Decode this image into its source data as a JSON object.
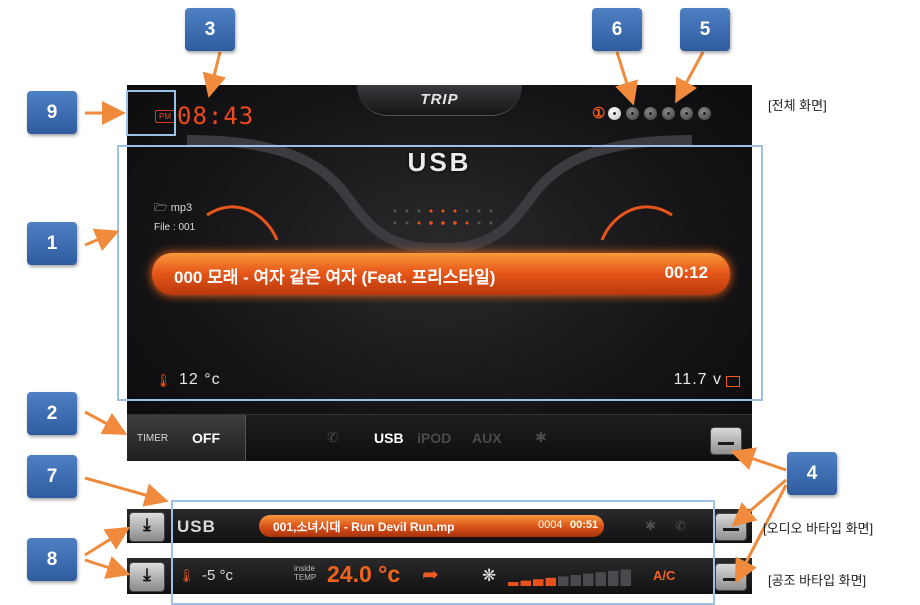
{
  "main_screen": {
    "mode_tab": "TRIP",
    "clock_period": "PM",
    "clock_time": "08:43",
    "page_number": "①",
    "page_count": 6,
    "active_page": 1,
    "source_title": "USB",
    "folder_name": "mp3",
    "file_label": "File : 001",
    "track_title": "000  모래 - 여자 같은 여자 (Feat. 프리스타일)",
    "track_time": "00:12",
    "temperature": "12 °c",
    "voltage": "11.7 v"
  },
  "source_bar": {
    "timer_label": "TIMER",
    "timer_value": "OFF",
    "sources": [
      "USB",
      "iPOD",
      "AUX"
    ],
    "active_source": "USB",
    "phone_icon": "phone-icon",
    "bluetooth_icon": "bluetooth-icon"
  },
  "audio_strip": {
    "source": "USB",
    "track": "001,소녀시대 - Run Devil Run.mp",
    "track_number": "0004",
    "time": "00:51"
  },
  "hvac_strip": {
    "outside_temp": "-5 °c",
    "inside_label": "inside TEMP",
    "inside_temp": "24.0 °c",
    "ac_label": "A/C",
    "fan_level": 4,
    "fan_levels_total": 10
  },
  "annotations": {
    "callouts": [
      "1",
      "2",
      "3",
      "4",
      "5",
      "6",
      "7",
      "8",
      "9"
    ],
    "full_screen_note": "[전체 화면]",
    "audio_strip_note": "[오디오 바타입 화면]",
    "hvac_strip_note": "[공조 바타입 화면]"
  },
  "colors": {
    "accent_orange": "#ee4a1e",
    "callout_blue": "#3b6db3",
    "frame_blue": "#9cc0e6"
  }
}
